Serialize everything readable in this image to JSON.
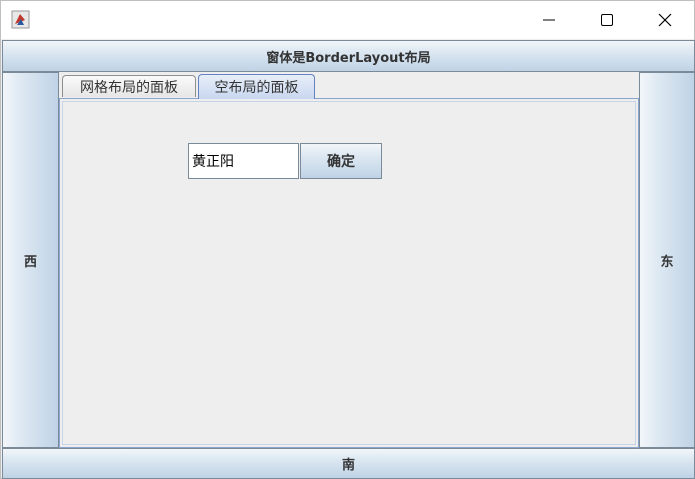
{
  "window": {
    "title": "",
    "controls": {
      "minimize_icon": "minimize-icon",
      "maximize_icon": "maximize-icon",
      "close_icon": "close-icon"
    }
  },
  "borders": {
    "north": "窗体是BorderLayout布局",
    "south": "南",
    "west": "西",
    "east": "东"
  },
  "tabs": [
    {
      "label": "网格布局的面板",
      "selected": false
    },
    {
      "label": "空布局的面板",
      "selected": true
    }
  ],
  "panel": {
    "text_field_value": "黄正阳",
    "ok_button_label": "确定"
  },
  "colors": {
    "button_gradient_top": "#f2f6fa",
    "button_gradient_bottom": "#bfd3e6",
    "selected_tab": "#c8d7f0",
    "background": "#eeeeee"
  }
}
